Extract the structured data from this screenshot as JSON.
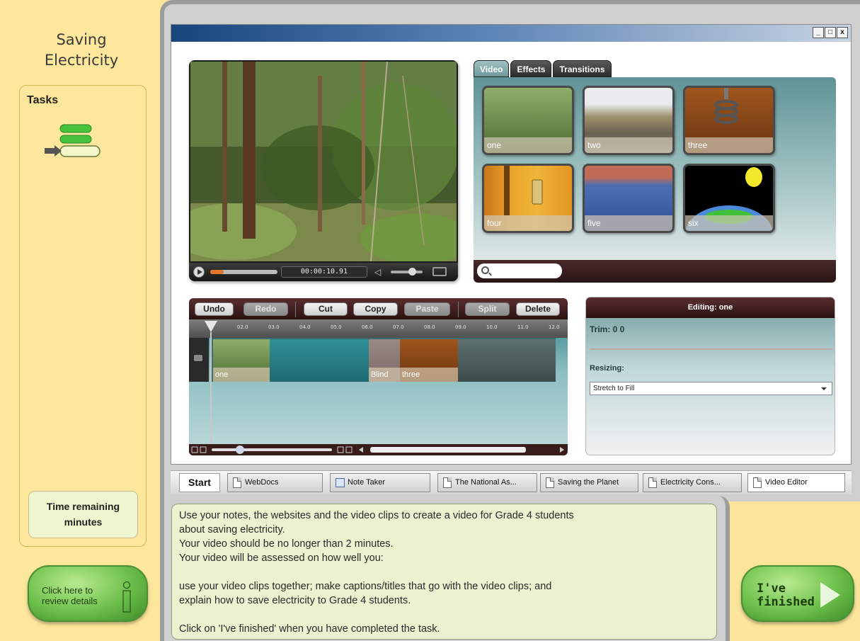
{
  "app": {
    "title_line1": "Saving",
    "title_line2": "Electricity"
  },
  "sidebar": {
    "tasks_label": "Tasks",
    "time_line1": "Time remaining",
    "time_line2": "minutes",
    "review_line1": "Click here to",
    "review_line2": "review details"
  },
  "window": {
    "controls": [
      "_",
      "͡",
      "x"
    ],
    "control_icons": [
      "minimize-icon",
      "restore-icon",
      "close-icon"
    ]
  },
  "player": {
    "time": "00:00:10.91",
    "progress": 0.2,
    "volume": 0.65
  },
  "library": {
    "tabs": [
      "Video",
      "Effects",
      "Transitions"
    ],
    "active_tab": "Video",
    "clips": [
      "one",
      "two",
      "three",
      "four",
      "five",
      "six"
    ],
    "search_placeholder": ""
  },
  "toolbar": {
    "undo": "Undo",
    "redo": "Redo",
    "cut": "Cut",
    "copy": "Copy",
    "paste": "Paste",
    "split": "Split",
    "delete": "Delete"
  },
  "timeline": {
    "ticks": [
      "02.0",
      "03.0",
      "04.0",
      "05.0",
      "06.0",
      "07.0",
      "08.0",
      "09.0",
      "10.0",
      "11.0",
      "12.0"
    ],
    "clips": [
      "one",
      "Blind",
      "three"
    ]
  },
  "editing": {
    "header": "Editing: one",
    "trim_label": "Trim: 0 0",
    "resizing_label": "Resizing:",
    "resize_value": "Stretch to Fill"
  },
  "taskbar": {
    "start": "Start",
    "tabs": [
      "WebDocs",
      "Note Taker",
      "The National As...",
      "Saving the Planet",
      "Electricity Cons...",
      "Video Editor"
    ],
    "active": "Video Editor"
  },
  "instructions": {
    "line1": "Use your notes, the websites and the video clips to create a video for Grade 4 students",
    "line2": "about saving electricity.",
    "line3": "Your video should be no longer than 2 minutes.",
    "line4": "Your video will be assessed on how well you:",
    "line5": "use your video clips together; make captions/titles that go with the video clips; and",
    "line6": "explain how to save electricity to Grade 4 students.",
    "line7": "Click on 'I've finished' when you have completed the task."
  },
  "finished": {
    "line1": "I've",
    "line2": "finished"
  }
}
